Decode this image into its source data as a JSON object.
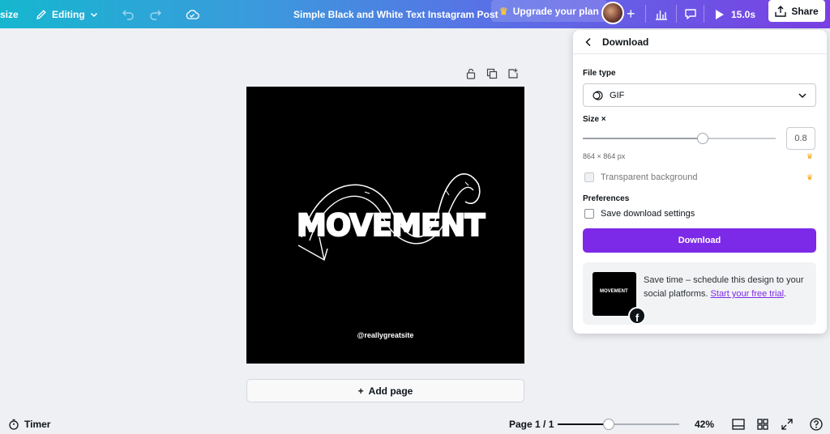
{
  "topbar": {
    "resize_label": "size",
    "editing_label": "Editing",
    "title": "Simple Black and White Text Instagram Post",
    "upgrade_label": "Upgrade your plan",
    "duration": "15.0s",
    "share_label": "Share"
  },
  "canvas": {
    "headline": "MOVEMENT",
    "handle": "@reallygreatsite",
    "add_page_label": "Add page"
  },
  "bottombar": {
    "timer_label": "Timer",
    "page_indicator": "Page 1 / 1",
    "zoom_percent": 42,
    "zoom_label": "42%"
  },
  "download_panel": {
    "title": "Download",
    "file_type_label": "File type",
    "file_type_value": "GIF",
    "size_label": "Size ×",
    "size_value": "0.8",
    "size_slider_fraction": 0.62,
    "dimensions": "864 × 864 px",
    "transparent_label": "Transparent background",
    "preferences_label": "Preferences",
    "save_settings_label": "Save download settings",
    "download_button": "Download",
    "promo_text": "Save time – schedule this design to your social platforms.",
    "promo_link": "Start your free trial",
    "promo_period": ".",
    "promo_thumb_text": "MOVEMENT"
  },
  "colors": {
    "accent": "#7d2ae8",
    "premium": "#f4a000"
  }
}
